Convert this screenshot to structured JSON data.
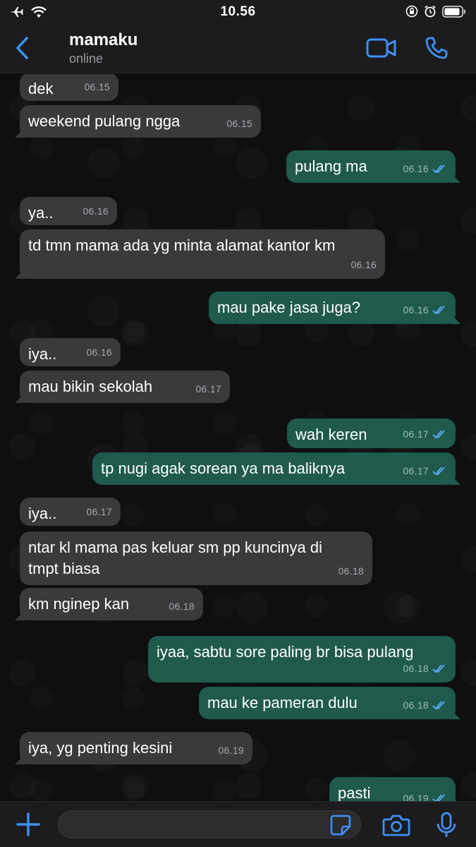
{
  "status_bar": {
    "time": "10.56"
  },
  "header": {
    "name": "mamaku",
    "status": "online"
  },
  "messages": [
    {
      "dir": "in",
      "text": "dek",
      "time": "06.15"
    },
    {
      "dir": "in",
      "text": "weekend pulang ngga",
      "time": "06.15"
    },
    {
      "dir": "out",
      "text": "pulang ma",
      "time": "06.16"
    },
    {
      "dir": "in",
      "text": "ya..",
      "time": "06.16"
    },
    {
      "dir": "in",
      "text": "td tmn mama ada yg minta alamat kantor km",
      "time": "06.16"
    },
    {
      "dir": "out",
      "text": "mau pake jasa juga?",
      "time": "06.16"
    },
    {
      "dir": "in",
      "text": "iya..",
      "time": "06.16"
    },
    {
      "dir": "in",
      "text": "mau bikin sekolah",
      "time": "06.17"
    },
    {
      "dir": "out",
      "text": "wah keren",
      "time": "06.17"
    },
    {
      "dir": "out",
      "text": "tp nugi agak sorean ya ma baliknya",
      "time": "06.17"
    },
    {
      "dir": "in",
      "text": "iya..",
      "time": "06.17"
    },
    {
      "dir": "in",
      "text": "ntar kl mama pas keluar sm pp kuncinya di\ntmpt biasa",
      "time": "06.18"
    },
    {
      "dir": "in",
      "text": "km nginep kan",
      "time": "06.18"
    },
    {
      "dir": "out",
      "text": "iyaa, sabtu sore paling br bisa pulang",
      "time": "06.18"
    },
    {
      "dir": "out",
      "text": "mau ke pameran dulu",
      "time": "06.18"
    },
    {
      "dir": "in",
      "text": "iya, yg penting kesini",
      "time": "06.19"
    },
    {
      "dir": "out",
      "text": "pasti",
      "time": "06.19"
    }
  ],
  "colors": {
    "accent": "#3e8ff5",
    "incoming": "#3a3a3c",
    "outgoing": "#1f5a4d",
    "ticks": "#5eb1ff"
  },
  "icons": [
    "airplane-icon",
    "wifi-icon",
    "orientation-lock-icon",
    "alarm-icon",
    "battery-icon",
    "back-chevron-icon",
    "video-call-icon",
    "phone-icon",
    "plus-icon",
    "sticker-icon",
    "camera-icon",
    "microphone-icon"
  ]
}
